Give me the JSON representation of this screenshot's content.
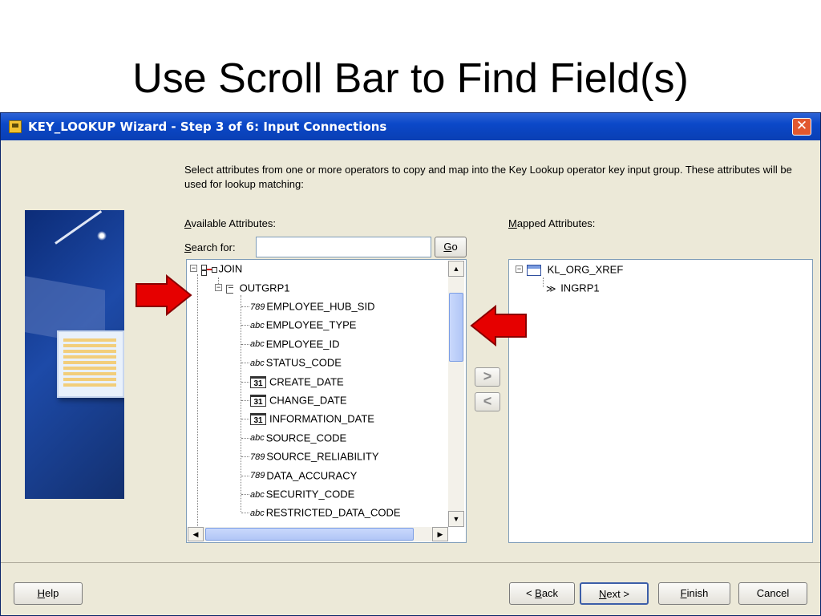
{
  "slide": {
    "title": "Use Scroll Bar to Find Field(s)"
  },
  "window": {
    "title": "KEY_LOOKUP Wizard - Step 3 of 6: Input Connections",
    "close_glyph": "✕"
  },
  "description": "Select attributes from one or more operators to copy and map into the Key Lookup operator key input group.  These attributes will be used for lookup matching:",
  "available": {
    "label_prefix": "A",
    "label_rest": "vailable Attributes:",
    "search_label_prefix": "S",
    "search_label_rest": "earch for:",
    "search_value": "",
    "go_prefix": "G",
    "go_rest": "o",
    "tree": {
      "root": {
        "label": "JOIN",
        "icon": "join-operator-icon"
      },
      "group": {
        "label": "OUTGRP1",
        "icon": "group-icon"
      },
      "attributes": [
        {
          "type": "number",
          "type_glyph": "789",
          "label": "EMPLOYEE_HUB_SID"
        },
        {
          "type": "text",
          "type_glyph": "abc",
          "label": "EMPLOYEE_TYPE"
        },
        {
          "type": "text",
          "type_glyph": "abc",
          "label": "EMPLOYEE_ID"
        },
        {
          "type": "text",
          "type_glyph": "abc",
          "label": "STATUS_CODE"
        },
        {
          "type": "date",
          "type_glyph": "31",
          "label": "CREATE_DATE"
        },
        {
          "type": "date",
          "type_glyph": "31",
          "label": "CHANGE_DATE"
        },
        {
          "type": "date",
          "type_glyph": "31",
          "label": "INFORMATION_DATE"
        },
        {
          "type": "text",
          "type_glyph": "abc",
          "label": "SOURCE_CODE"
        },
        {
          "type": "number",
          "type_glyph": "789",
          "label": "SOURCE_RELIABILITY"
        },
        {
          "type": "number",
          "type_glyph": "789",
          "label": "DATA_ACCURACY"
        },
        {
          "type": "text",
          "type_glyph": "abc",
          "label": "SECURITY_CODE"
        },
        {
          "type": "text",
          "type_glyph": "abc",
          "label": "RESTRICTED_DATA_CODE"
        }
      ]
    }
  },
  "mapped": {
    "label_prefix": "M",
    "label_rest": "apped Attributes:",
    "tree": {
      "root": {
        "label": "KL_ORG_XREF",
        "icon": "table-operator-icon"
      },
      "group": {
        "label": "INGRP1",
        "icon": "input-group-icon"
      }
    }
  },
  "move_buttons": {
    "add_glyph": ">",
    "remove_glyph": "<"
  },
  "footer": {
    "help_prefix": "H",
    "help_rest": "elp",
    "back_pre": "< ",
    "back_prefix": "B",
    "back_rest": "ack",
    "next_prefix": "N",
    "next_rest": "ext >",
    "finish_prefix": "F",
    "finish_rest": "inish",
    "cancel_label": "Cancel"
  },
  "colors": {
    "titlebar": "#0b48c8",
    "dialog_bg": "#ece9d8",
    "callout_arrow": "#e60000"
  }
}
